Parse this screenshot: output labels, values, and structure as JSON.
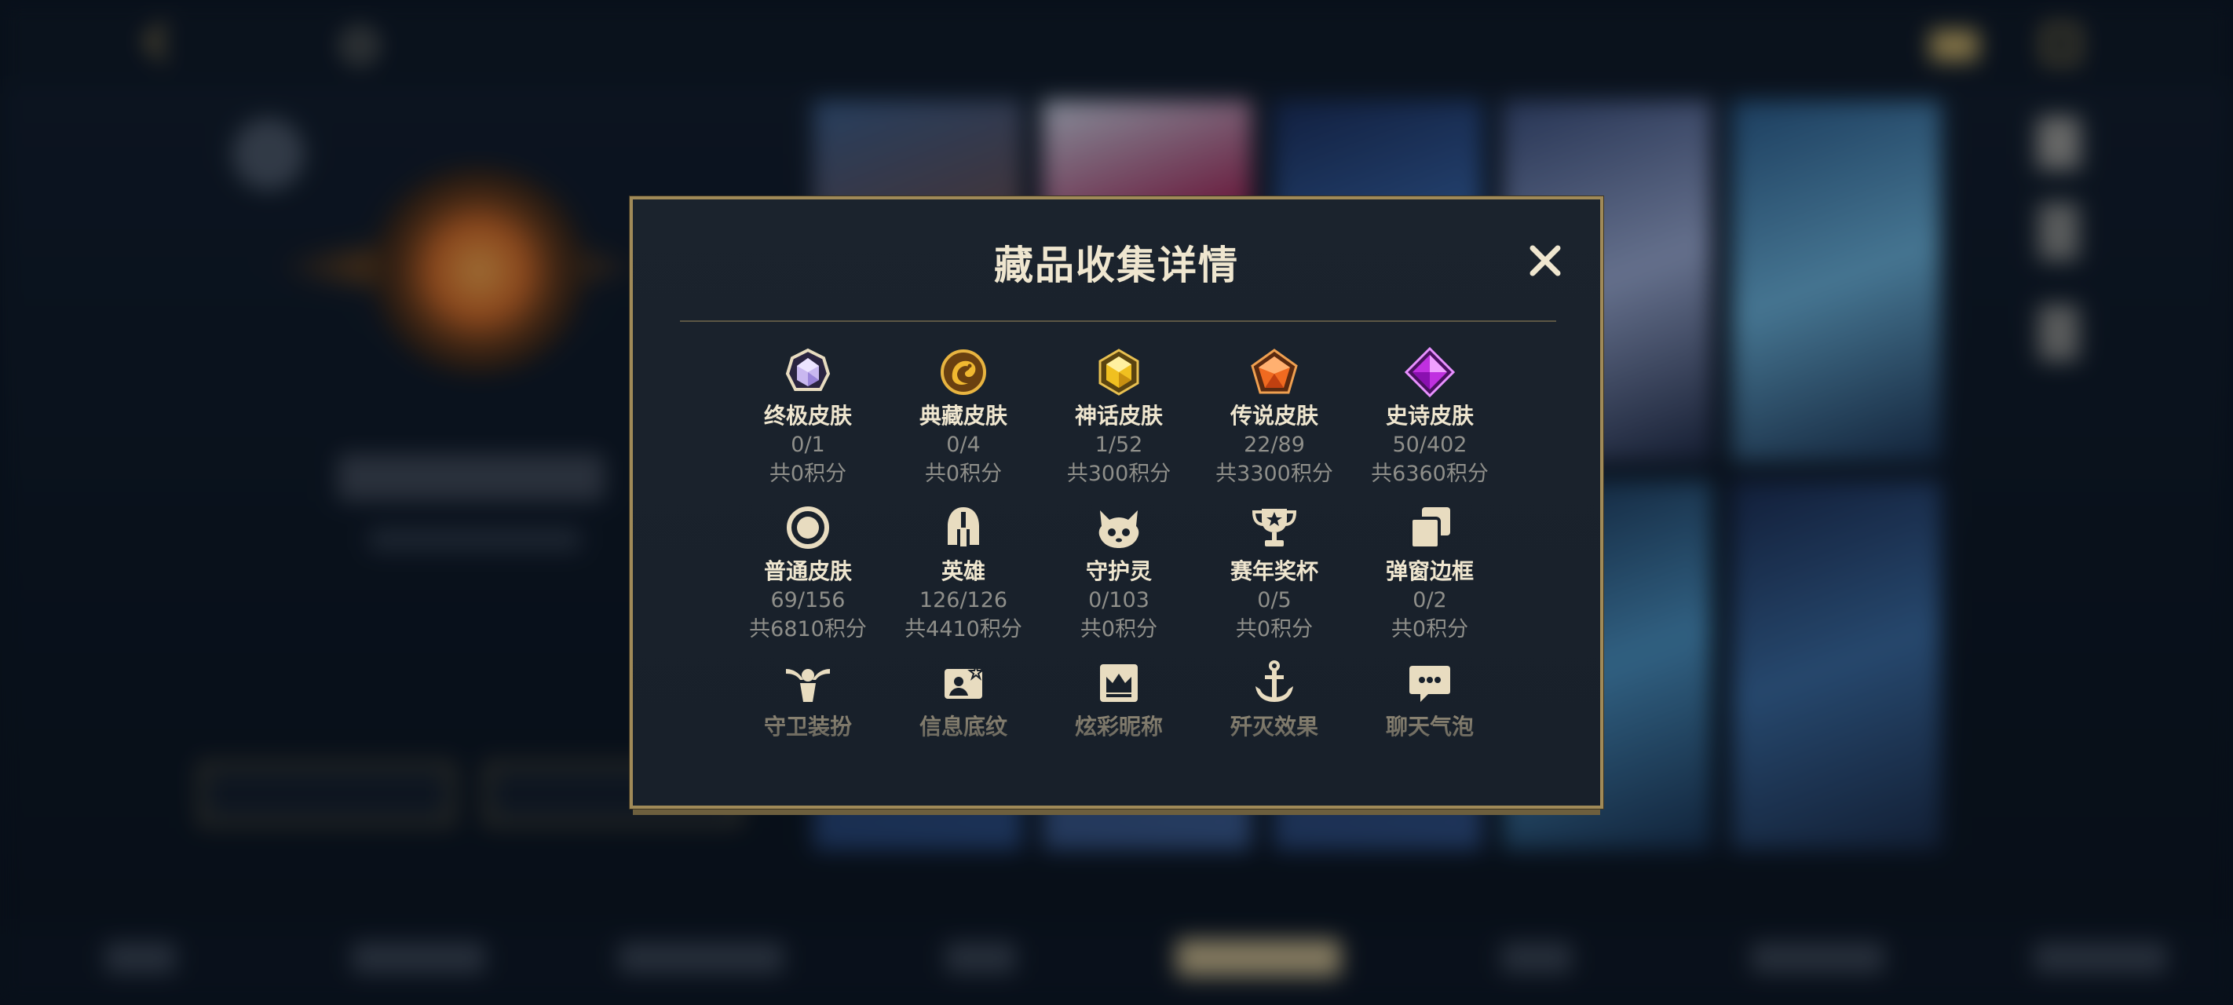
{
  "modal": {
    "title": "藏品收集详情",
    "close_label": "✕"
  },
  "items": [
    {
      "name": "终极皮肤",
      "count": "0/1",
      "points": "共0积分",
      "icon": "ultimate-skin-gem-icon",
      "color": "#c9b8f0"
    },
    {
      "name": "典藏皮肤",
      "count": "0/4",
      "points": "共0积分",
      "icon": "collection-skin-dragon-icon",
      "color": "#e0a030"
    },
    {
      "name": "神话皮肤",
      "count": "1/52",
      "points": "共300积分",
      "icon": "mythic-skin-gem-icon",
      "color": "#f0c020"
    },
    {
      "name": "传说皮肤",
      "count": "22/89",
      "points": "共3300积分",
      "icon": "legend-skin-gem-icon",
      "color": "#f06a20"
    },
    {
      "name": "史诗皮肤",
      "count": "50/402",
      "points": "共6360积分",
      "icon": "epic-skin-gem-icon",
      "color": "#c030e0"
    },
    {
      "name": "普通皮肤",
      "count": "69/156",
      "points": "共6810积分",
      "icon": "normal-skin-ring-icon",
      "color": "#e8dcc0"
    },
    {
      "name": "英雄",
      "count": "126/126",
      "points": "共4410积分",
      "icon": "hero-helmet-icon",
      "color": "#e8dcc0"
    },
    {
      "name": "守护灵",
      "count": "0/103",
      "points": "共0积分",
      "icon": "guardian-spirit-icon",
      "color": "#e8dcc0"
    },
    {
      "name": "赛年奖杯",
      "count": "0/5",
      "points": "共0积分",
      "icon": "trophy-icon",
      "color": "#e8dcc0"
    },
    {
      "name": "弹窗边框",
      "count": "0/2",
      "points": "共0积分",
      "icon": "popup-frame-icon",
      "color": "#e8dcc0"
    },
    {
      "name": "守卫装扮",
      "icon": "guard-outfit-icon",
      "color": "#e8dcc0"
    },
    {
      "name": "信息底纹",
      "icon": "info-background-icon",
      "color": "#e8dcc0"
    },
    {
      "name": "炫彩昵称",
      "icon": "colorful-nickname-icon",
      "color": "#e8dcc0"
    },
    {
      "name": "歼灭效果",
      "icon": "elimination-effect-icon",
      "color": "#e8dcc0"
    },
    {
      "name": "聊天气泡",
      "icon": "chat-bubble-icon",
      "color": "#e8dcc0"
    }
  ],
  "colors": {
    "accent_gold": "#a08a58",
    "title_text": "#efe6cf",
    "muted_text": "#8f8f8a"
  }
}
